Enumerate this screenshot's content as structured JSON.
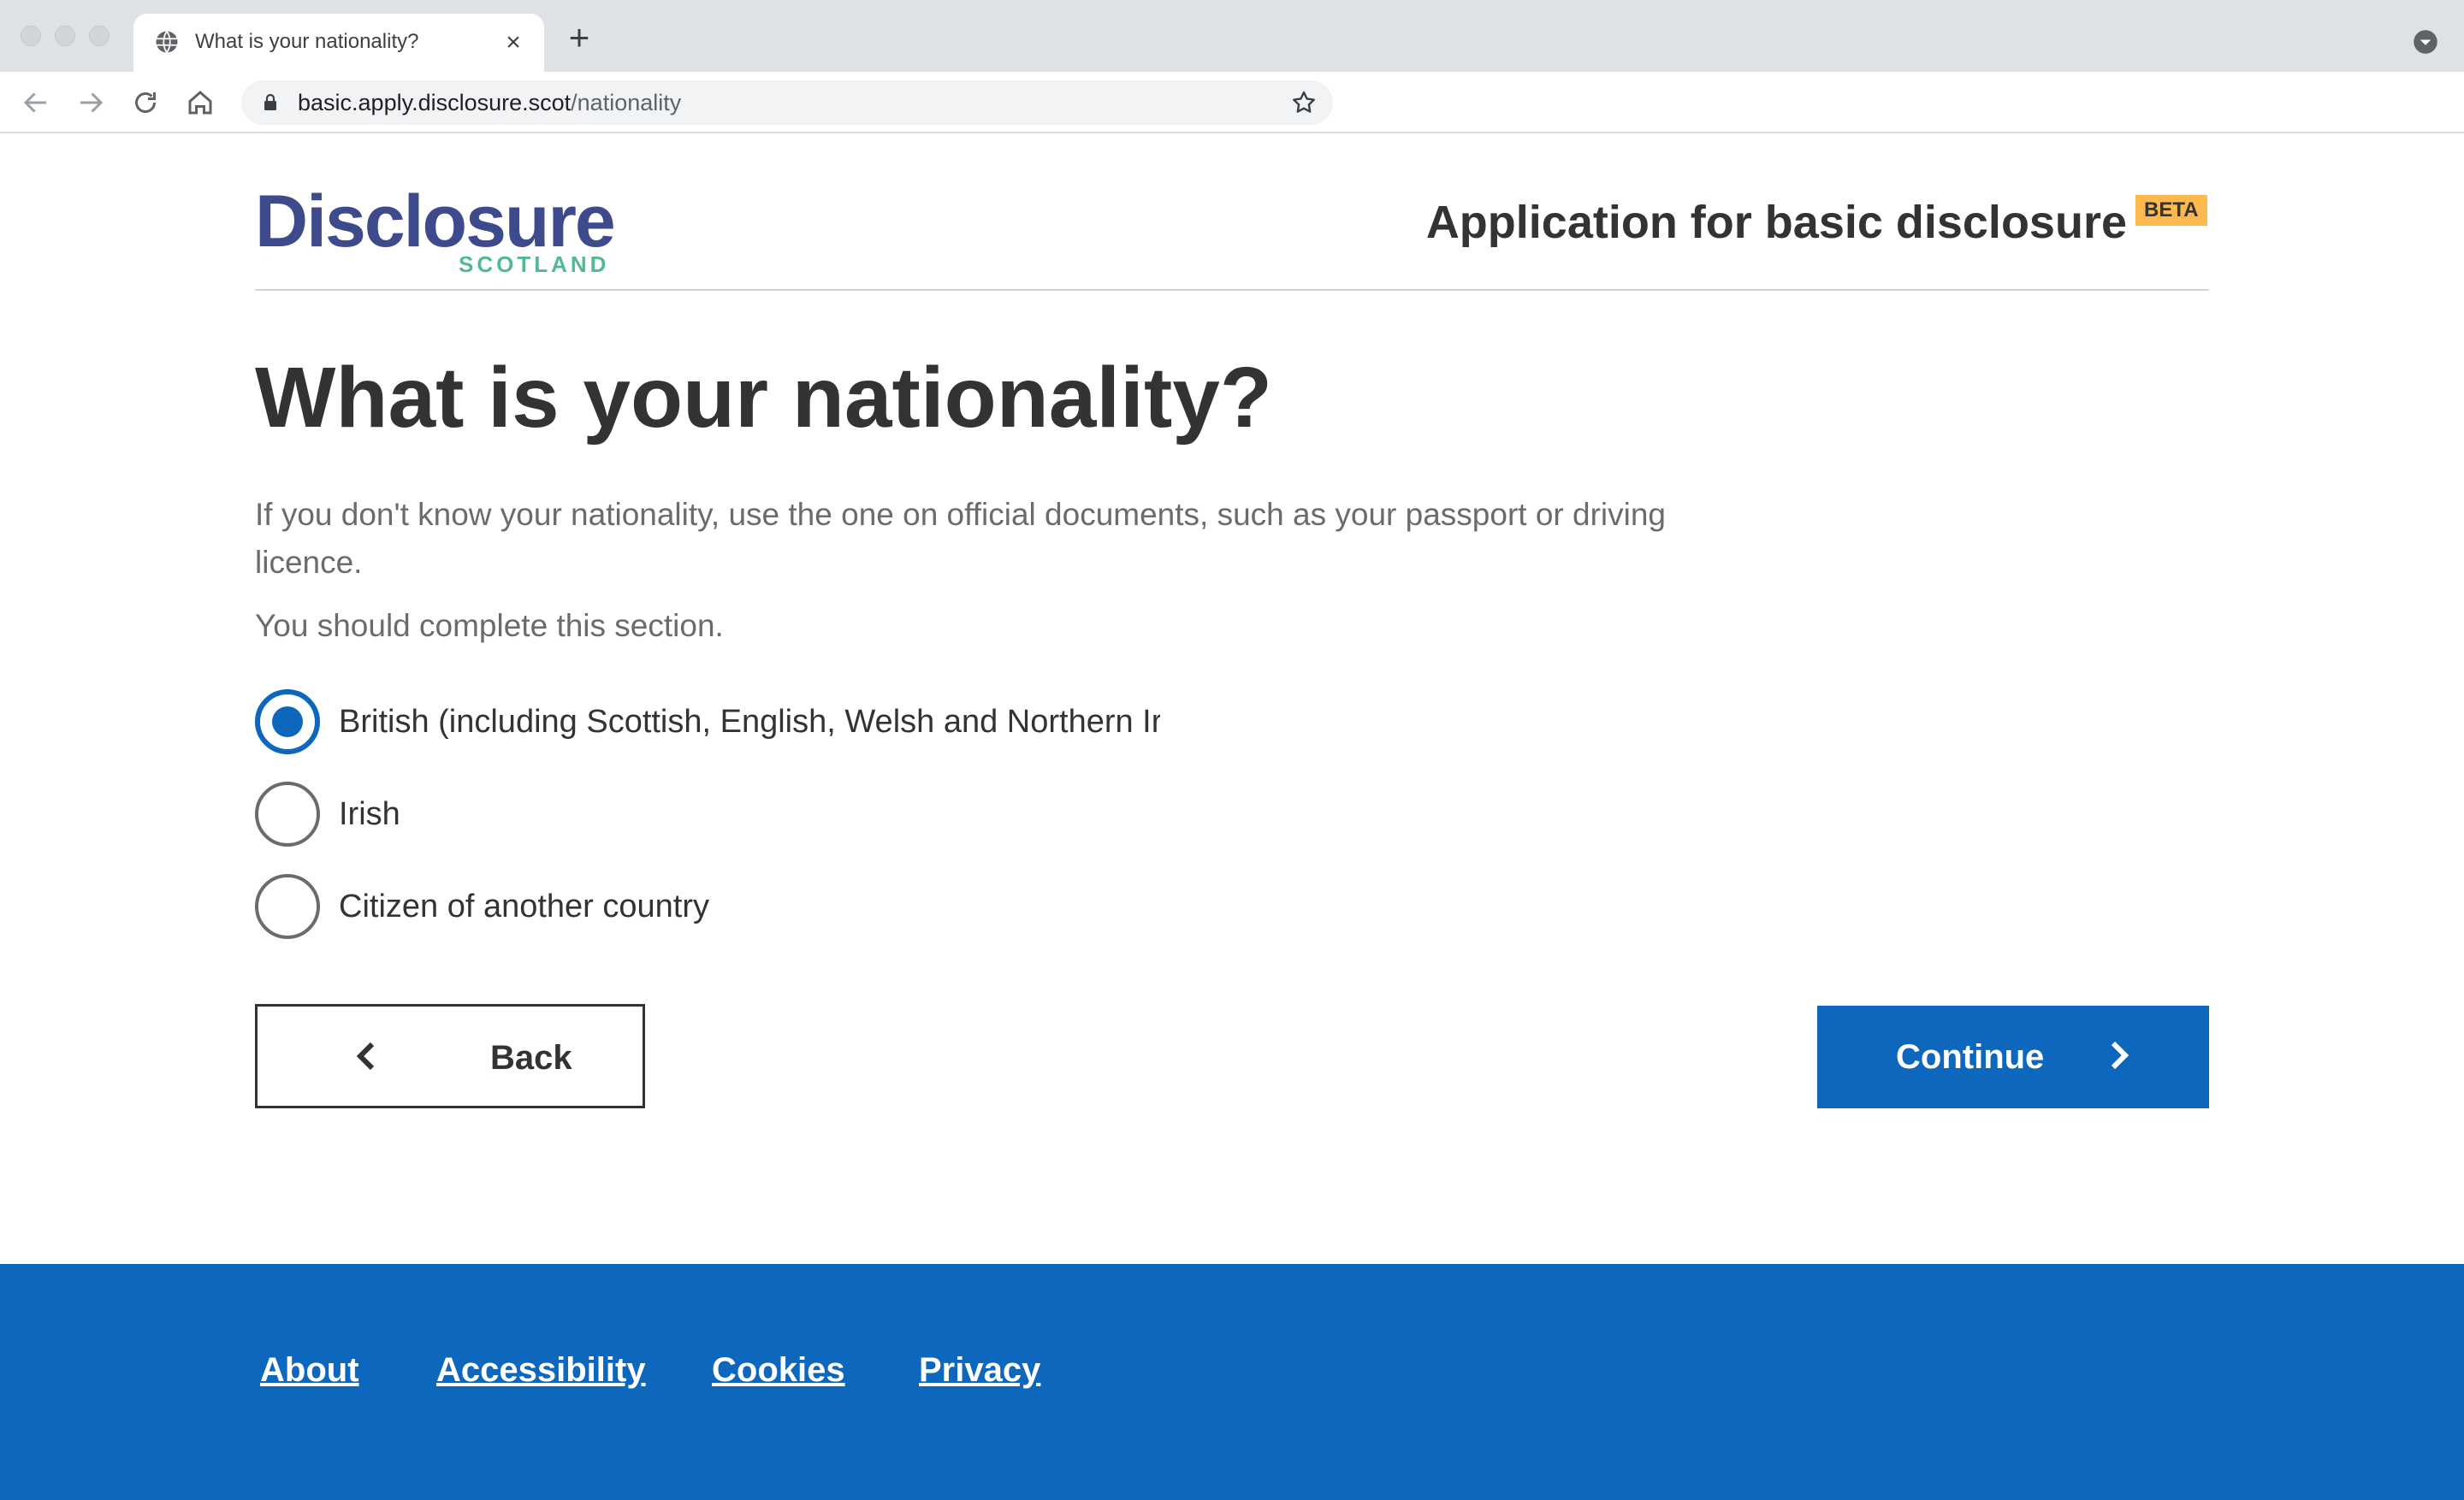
{
  "browser": {
    "tab_title": "What is your nationality?",
    "url_host": "basic.apply.disclosure.scot",
    "url_path": "/nationality",
    "icons": [
      "globe-icon",
      "close-icon",
      "plus-icon",
      "back-arrow-icon",
      "forward-arrow-icon",
      "reload-icon",
      "home-icon",
      "lock-icon",
      "star-icon",
      "chevron-down-icon"
    ]
  },
  "header": {
    "logo_word": "Disclosure",
    "logo_sub": "SCOTLAND",
    "service_name": "Application for basic disclosure",
    "beta_tag": "BETA"
  },
  "main": {
    "title": "What is your nationality?",
    "hint": "If you don't know your nationality, use the one on official documents, such as your passport or driving licence.",
    "hint2": "You should complete this section.",
    "options": [
      {
        "label": "British (including Scottish, English, Welsh and Northern Irish)",
        "checked": true
      },
      {
        "label": "Irish",
        "checked": false
      },
      {
        "label": "Citizen of another country",
        "checked": false
      }
    ],
    "back_label": "Back",
    "continue_label": "Continue"
  },
  "footer": {
    "links": [
      "About",
      "Accessibility",
      "Cookies",
      "Privacy"
    ]
  },
  "colors": {
    "primary_blue": "#0d67bc",
    "beta_orange": "#fdb84e",
    "logo_navy": "#3d4a8c",
    "logo_green": "#52b89a",
    "text": "#333333"
  }
}
